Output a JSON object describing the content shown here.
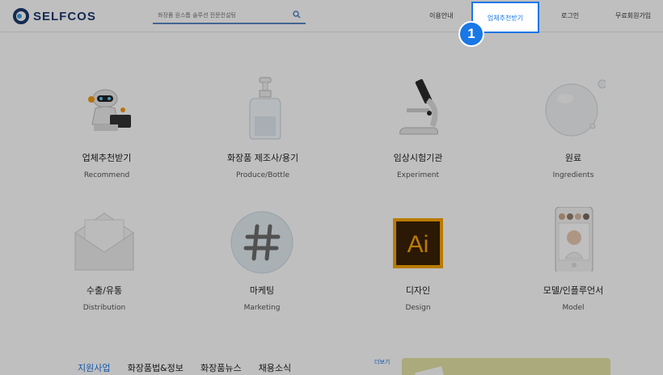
{
  "header": {
    "logo_text": "SELFCOS",
    "search_placeholder": "화장품 원스톱 솔루션 전문컨설팅",
    "nav": {
      "guide": "이용안내",
      "recommend": "업체추천받기",
      "login": "로그인",
      "signup": "무료회원가입"
    },
    "highlight_badge": "1"
  },
  "categories": [
    {
      "title": "업체추천받기",
      "subtitle": "Recommend",
      "icon": "robot-icon"
    },
    {
      "title": "화장품 제조사/용기",
      "subtitle": "Produce/Bottle",
      "icon": "pump-bottle-icon"
    },
    {
      "title": "임상시험기관",
      "subtitle": "Experiment",
      "icon": "microscope-icon"
    },
    {
      "title": "원료",
      "subtitle": "Ingredients",
      "icon": "bubble-icon"
    },
    {
      "title": "수출/유통",
      "subtitle": "Distribution",
      "icon": "envelope-icon"
    },
    {
      "title": "마케팅",
      "subtitle": "Marketing",
      "icon": "hashtag-icon"
    },
    {
      "title": "디자인",
      "subtitle": "Design",
      "icon": "illustrator-icon"
    },
    {
      "title": "모델/인플루언서",
      "subtitle": "Model",
      "icon": "phone-profile-icon"
    }
  ],
  "bottom": {
    "tabs": [
      "지원사업",
      "화장품법&정보",
      "화장품뉴스",
      "채용소식"
    ],
    "more_label": "더보기"
  },
  "colors": {
    "brand_navy": "#1c3a6e",
    "accent_blue": "#1a77e6",
    "promo_bg": "#e3e3a6"
  }
}
